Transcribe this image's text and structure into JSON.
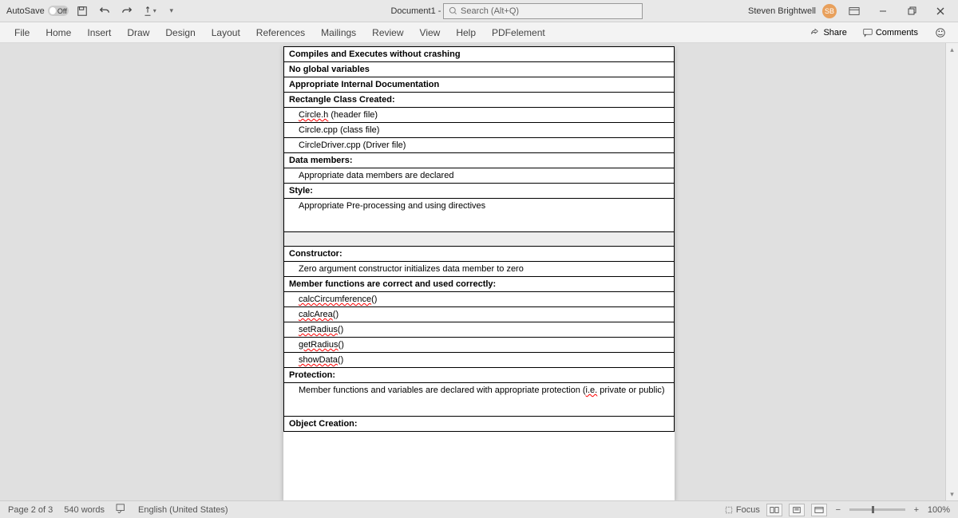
{
  "titlebar": {
    "autosave_label": "AutoSave",
    "autosave_state": "Off",
    "doc_title": "Document1 - Word",
    "search_placeholder": "Search (Alt+Q)",
    "user_name": "Steven Brightwell",
    "user_initials": "SB"
  },
  "ribbon": {
    "tabs": [
      "File",
      "Home",
      "Insert",
      "Draw",
      "Design",
      "Layout",
      "References",
      "Mailings",
      "Review",
      "View",
      "Help",
      "PDFelement"
    ],
    "share": "Share",
    "comments": "Comments"
  },
  "document": {
    "rows": [
      {
        "text": "Compiles and Executes without crashing",
        "cls": "hdr"
      },
      {
        "text": "No global variables",
        "cls": "hdr"
      },
      {
        "text": "Appropriate Internal Documentation",
        "cls": "hdr"
      },
      {
        "text": "Rectangle Class Created:",
        "cls": "hdr"
      },
      {
        "text": "Circle.h (header file)",
        "cls": "indent",
        "squig": "Circle.h"
      },
      {
        "text": "Circle.cpp (class file)",
        "cls": "indent"
      },
      {
        "text": "CircleDriver.cpp (Driver file)",
        "cls": "indent"
      },
      {
        "text": "Data members:",
        "cls": "hdr"
      },
      {
        "text": "Appropriate data members are declared",
        "cls": "indent"
      },
      {
        "text": "Style:",
        "cls": "hdr"
      },
      {
        "text": "Appropriate Pre-processing and using directives",
        "cls": "indent tall"
      },
      {
        "text": "",
        "cls": "gray-row"
      },
      {
        "text": "Constructor:",
        "cls": "hdr"
      },
      {
        "text": "Zero argument constructor initializes data member to zero",
        "cls": "indent"
      },
      {
        "text": "Member functions are correct and used correctly:",
        "cls": "hdr"
      },
      {
        "text": "calcCircumference()",
        "cls": "indent",
        "squig": "calcCircumference"
      },
      {
        "text": "calcArea()",
        "cls": "indent",
        "squig": "calcArea"
      },
      {
        "text": "setRadius()",
        "cls": "indent",
        "squig": "setRadius"
      },
      {
        "text": "getRadius()",
        "cls": "indent",
        "squig": "getRadius"
      },
      {
        "text": "showData()",
        "cls": "indent",
        "squig": "showData"
      },
      {
        "text": "Protection:",
        "cls": "hdr"
      },
      {
        "text": "Member functions and variables are declared with appropriate protection (i.e. private or public)",
        "cls": "indent tall",
        "squig": "i.e."
      },
      {
        "text": "Object Creation:",
        "cls": "hdr"
      }
    ]
  },
  "statusbar": {
    "page": "Page 2 of 3",
    "words": "540 words",
    "lang": "English (United States)",
    "focus": "Focus",
    "zoom": "100%"
  }
}
